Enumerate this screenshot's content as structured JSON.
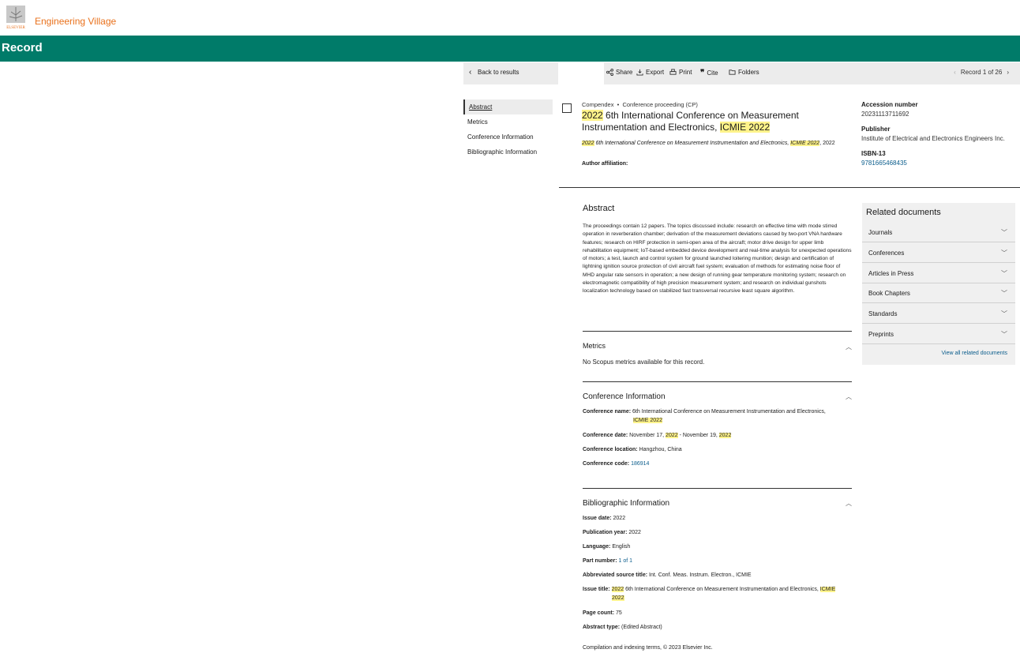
{
  "header": {
    "brand": "Engineering Village",
    "logo_text": "ELSEVIER",
    "record_title": "Record"
  },
  "toolbar": {
    "back": "Back to results",
    "share": "Share",
    "export": "Export",
    "print": "Print",
    "cite": "Cite",
    "folders": "Folders",
    "record_nav": "Record 1 of 26"
  },
  "leftnav": {
    "items": [
      "Abstract",
      "Metrics",
      "Conference Information",
      "Bibliographic Information"
    ]
  },
  "record": {
    "database": "Compendex",
    "doc_type": "Conference proceeding (CP)",
    "title_year": "2022",
    "title_main": " 6th International Conference on Measurement Instrumentation and Electronics, ",
    "title_acronym": "ICMIE 2022",
    "sub_year": "2022",
    "sub_main": " 6th International Conference on Measurement Instrumentation and Electronics, ",
    "sub_acronym": "ICMIE 2022",
    "sub_tail": ", 2022",
    "author_affiliation": "Author affiliation:"
  },
  "info": {
    "accession_label": "Accession number",
    "accession_value": "20231113711692",
    "publisher_label": "Publisher",
    "publisher_value": "Institute of Electrical and Electronics Engineers Inc.",
    "isbn_label": "ISBN-13",
    "isbn_value": "9781665468435"
  },
  "abstract": {
    "heading": "Abstract",
    "text": "The proceedings contain 12 papers. The topics discussed include: research on effective time with mode stirred operation in reverberation chamber; derivation of the measurement deviations caused by two-port VNA hardware features; research on HIRF protection in semi-open area of the aircraft; motor drive design for upper limb rehabilitation equipment; IoT-based embedded device development and real-time analysis for unexpected operations of motors; a test, launch and control system for ground launched loitering munition; design and certification of lightning ignition source protection of civil aircraft fuel system; evaluation of methods for estimating noise floor of MHD angular rate sensors in operation; a new design of running gear temperature monitoring system; research on electromagnetic compatibility of high precision measurement system; and research on individual gunshots localization technology based on stabilized fast transversal recursive least square algorithm."
  },
  "metrics": {
    "heading": "Metrics",
    "text": "No Scopus metrics available for this record."
  },
  "conference": {
    "heading": "Conference Information",
    "name_label": "Conference name:",
    "name_value": " 6th International Conference on Measurement Instrumentation and Electronics,",
    "name_acronym": "ICMIE 2022",
    "date_label": "Conference date:",
    "date_a": " November 17, ",
    "date_y1": "2022",
    "date_b": " - November 19, ",
    "date_y2": "2022",
    "location_label": "Conference location:",
    "location_value": " Hangzhou, China",
    "code_label": "Conference code:",
    "code_value": "186914"
  },
  "biblio": {
    "heading": "Bibliographic Information",
    "issue_date_label": "Issue date:",
    "issue_date_value": " 2022",
    "pub_year_label": "Publication year:",
    "pub_year_value": " 2022",
    "language_label": "Language:",
    "language_value": " English",
    "part_label": "Part number:",
    "part_value": "1 of 1",
    "abbrev_label": "Abbreviated source title:",
    "abbrev_value": " Int. Conf. Meas. Instrum. Electron., ICMIE",
    "issue_title_label": "Issue title:",
    "issue_title_year": "2022",
    "issue_title_main": " 6th International Conference on Measurement Instrumentation and Electronics, ",
    "issue_title_acronym1": "ICMIE",
    "issue_title_acronym2": "2022",
    "page_count_label": "Page count:",
    "page_count_value": " 75",
    "abstract_type_label": "Abstract type:",
    "abstract_type_value": " (Edited Abstract)",
    "copyright": "Compilation and indexing terms, © 2023 Elsevier Inc."
  },
  "related": {
    "heading": "Related documents",
    "items": [
      "Journals",
      "Conferences",
      "Articles in Press",
      "Book Chapters",
      "Standards",
      "Preprints"
    ],
    "view_all": "View all related documents"
  }
}
